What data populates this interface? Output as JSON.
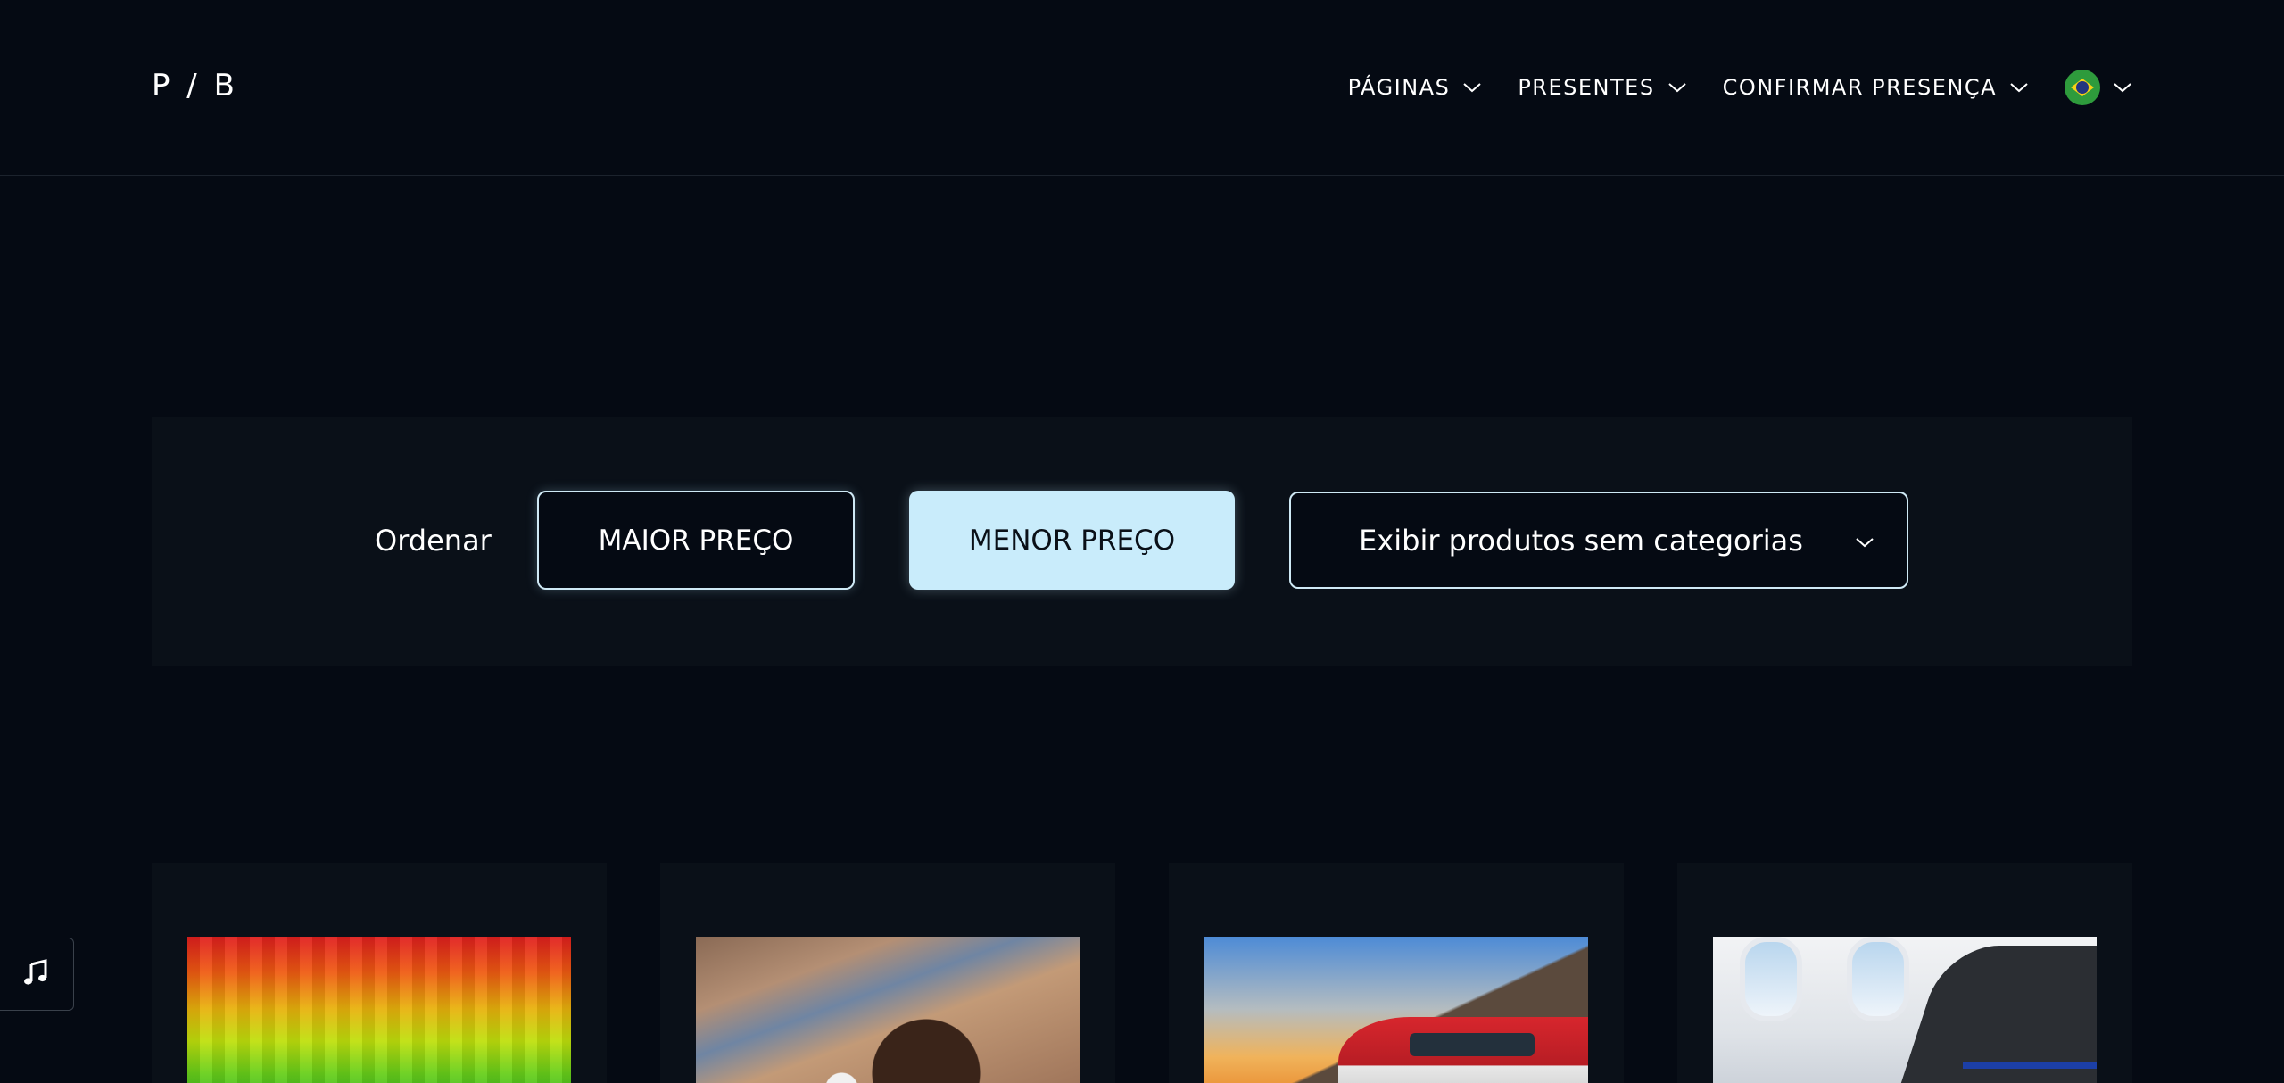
{
  "header": {
    "logo": "P / B",
    "nav": [
      {
        "label": "PÁGINAS"
      },
      {
        "label": "PRESENTES"
      },
      {
        "label": "CONFIRMAR PRESENÇA"
      }
    ],
    "language_icon": "brazil-flag-icon"
  },
  "filters": {
    "sort_label": "Ordenar",
    "sort_max_label": "MAIOR PREÇO",
    "sort_min_label": "MENOR PREÇO",
    "active_sort": "MENOR PREÇO",
    "category_select_value": "Exibir produtos sem categorias"
  },
  "products": [
    {
      "image": "colorful-pixel-art"
    },
    {
      "image": "chocolate-brigadeiro"
    },
    {
      "image": "red-train-at-sunset"
    },
    {
      "image": "airplane-cabin-seat"
    }
  ],
  "music_button_icon": "music-note-icon",
  "colors": {
    "background": "#050a13",
    "panel": "#0a1018",
    "accent": "#c9ecfb",
    "border": "#cfe9f5"
  }
}
